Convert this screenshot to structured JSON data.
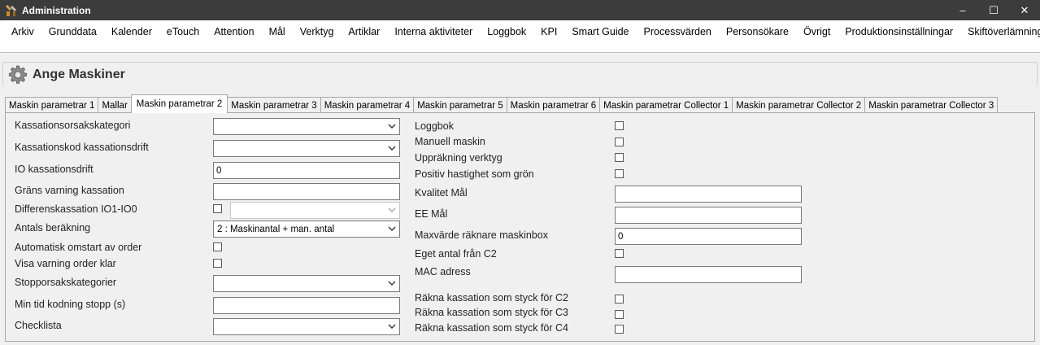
{
  "window": {
    "title": "Administration",
    "minimize": "–",
    "maximize": "☐",
    "close": "✕"
  },
  "menu": [
    "Arkiv",
    "Grunddata",
    "Kalender",
    "eTouch",
    "Attention",
    "Mål",
    "Verktyg",
    "Artiklar",
    "Interna aktiviteter",
    "Loggbok",
    "KPI",
    "Smart Guide",
    "Processvärden",
    "Personsökare",
    "Övrigt",
    "Produktionsinställningar",
    "Skiftöverlämning"
  ],
  "page": {
    "title": "Ange Maskiner"
  },
  "tabs": [
    "Maskin parametrar 1",
    "Mallar",
    "Maskin parametrar 2",
    "Maskin parametrar 3",
    "Maskin parametrar 4",
    "Maskin parametrar 5",
    "Maskin parametrar 6",
    "Maskin parametrar Collector 1",
    "Maskin parametrar Collector 2",
    "Maskin parametrar Collector 3"
  ],
  "active_tab": "Maskin parametrar 2",
  "left": {
    "kassationsorsakskategori": {
      "label": "Kassationsorsakskategori",
      "value": ""
    },
    "kassationskod": {
      "label": "Kassationskod kassationsdrift",
      "value": ""
    },
    "io_kassationsdrift": {
      "label": "IO kassationsdrift",
      "value": "0"
    },
    "grans_varning": {
      "label": "Gräns varning kassation",
      "value": ""
    },
    "differenskassation": {
      "label": "Differenskassation IO1-IO0",
      "checked": false,
      "value": ""
    },
    "antals_berakning": {
      "label": "Antals beräkning",
      "value": "2 : Maskinantal + man. antal"
    },
    "automatisk_omstart": {
      "label": "Automatisk omstart av order",
      "checked": false
    },
    "visa_varning": {
      "label": "Visa varning order klar",
      "checked": false
    },
    "stopporsakskategorier": {
      "label": "Stopporsakskategorier",
      "value": ""
    },
    "min_tid": {
      "label": "Min tid kodning stopp (s)",
      "value": ""
    },
    "checklista": {
      "label": "Checklista",
      "value": ""
    }
  },
  "right": {
    "loggbok": {
      "label": "Loggbok",
      "checked": false
    },
    "manuell_maskin": {
      "label": "Manuell maskin",
      "checked": false
    },
    "upprakning_verktyg": {
      "label": "Uppräkning verktyg",
      "checked": false
    },
    "positiv_hastighet": {
      "label": "Positiv hastighet som grön",
      "checked": false
    },
    "kvalitet_mal": {
      "label": "Kvalitet Mål",
      "value": ""
    },
    "ee_mal": {
      "label": "EE Mål",
      "value": ""
    },
    "maxvarde": {
      "label": "Maxvärde räknare maskinbox",
      "value": "0"
    },
    "eget_antal": {
      "label": "Eget antal från C2",
      "checked": false
    },
    "mac_adress": {
      "label": "MAC adress",
      "value": ""
    },
    "rakna_c2": {
      "label": "Räkna kassation som styck för C2",
      "checked": false
    },
    "rakna_c3": {
      "label": "Räkna kassation som styck för C3",
      "checked": false
    },
    "rakna_c4": {
      "label": "Räkna kassation som styck för C4",
      "checked": false
    }
  },
  "colors": {
    "titlebar": "#3c3c3c",
    "background": "#f0f0f0",
    "border": "#a8a8a8"
  },
  "icons": {
    "app": "tools-icon",
    "page": "gear-icon",
    "dropdown": "chevron-down-icon"
  }
}
